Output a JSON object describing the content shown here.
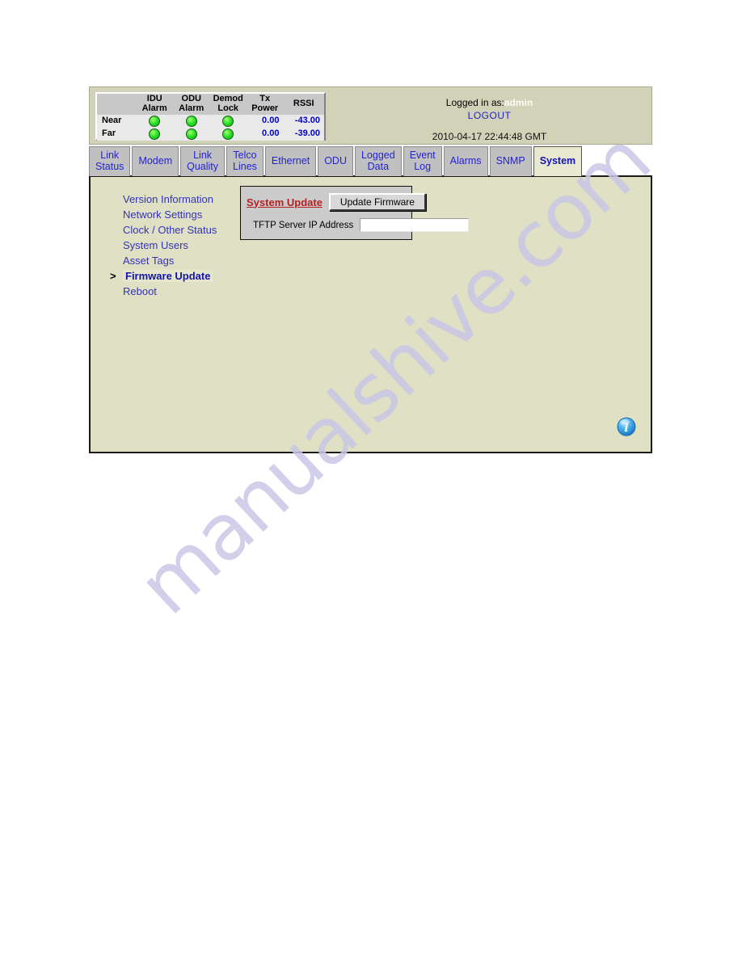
{
  "header": {
    "status_table": {
      "columns": [
        "",
        "IDU\nAlarm",
        "ODU\nAlarm",
        "Demod\nLock",
        "Tx\nPower",
        "RSSI"
      ],
      "rows": [
        {
          "label": "Near",
          "idu_alarm": "led-green",
          "odu_alarm": "led-green",
          "demod_lock": "led-green",
          "tx_power": "0.00",
          "rssi": "-43.00"
        },
        {
          "label": "Far",
          "idu_alarm": "led-green",
          "odu_alarm": "led-green",
          "demod_lock": "led-green",
          "tx_power": "0.00",
          "rssi": "-39.00"
        }
      ]
    },
    "logged_in_prefix": "Logged in as:",
    "user": "admin",
    "logout_label": "LOGOUT",
    "timestamp": "2010-04-17 22:44:48 GMT"
  },
  "tabs": [
    {
      "label": "Link\nStatus",
      "active": false
    },
    {
      "label": "Modem",
      "active": false
    },
    {
      "label": "Link\nQuality",
      "active": false
    },
    {
      "label": "Telco\nLines",
      "active": false
    },
    {
      "label": "Ethernet",
      "active": false
    },
    {
      "label": "ODU",
      "active": false
    },
    {
      "label": "Logged\nData",
      "active": false
    },
    {
      "label": "Event\nLog",
      "active": false
    },
    {
      "label": "Alarms",
      "active": false
    },
    {
      "label": "SNMP",
      "active": false
    },
    {
      "label": "System",
      "active": true
    }
  ],
  "sidebar": {
    "items": [
      {
        "label": "Version Information",
        "current": false
      },
      {
        "label": "Network Settings",
        "current": false
      },
      {
        "label": "Clock / Other Status",
        "current": false
      },
      {
        "label": "System Users",
        "current": false
      },
      {
        "label": "Asset Tags",
        "current": false
      },
      {
        "label": "Firmware Update",
        "current": true
      },
      {
        "label": "Reboot",
        "current": false
      }
    ],
    "current_marker": ">"
  },
  "update_form": {
    "title": "System Update",
    "button_label": "Update Firmware",
    "field_label": "TFTP Server IP Address",
    "field_value": "",
    "field_placeholder": ""
  },
  "info_icon": {
    "name": "info-icon",
    "glyph": "i"
  },
  "watermark": {
    "text": "manualshive.com"
  },
  "colors": {
    "page_background": "#ffffff",
    "header_background": "#d2d2b8",
    "content_background": "#e0e0c4",
    "tab_background": "#c0c0c0",
    "tab_active_background": "#e9e9d2",
    "tab_text": "#2323d6",
    "led_green": "#2ee02e",
    "value_blue": "#0000cc",
    "form_title_red": "#b32222",
    "form_background": "#cbcbcb",
    "info_icon_blue": "#2f9fe0",
    "watermark": "#c9c7e6"
  }
}
